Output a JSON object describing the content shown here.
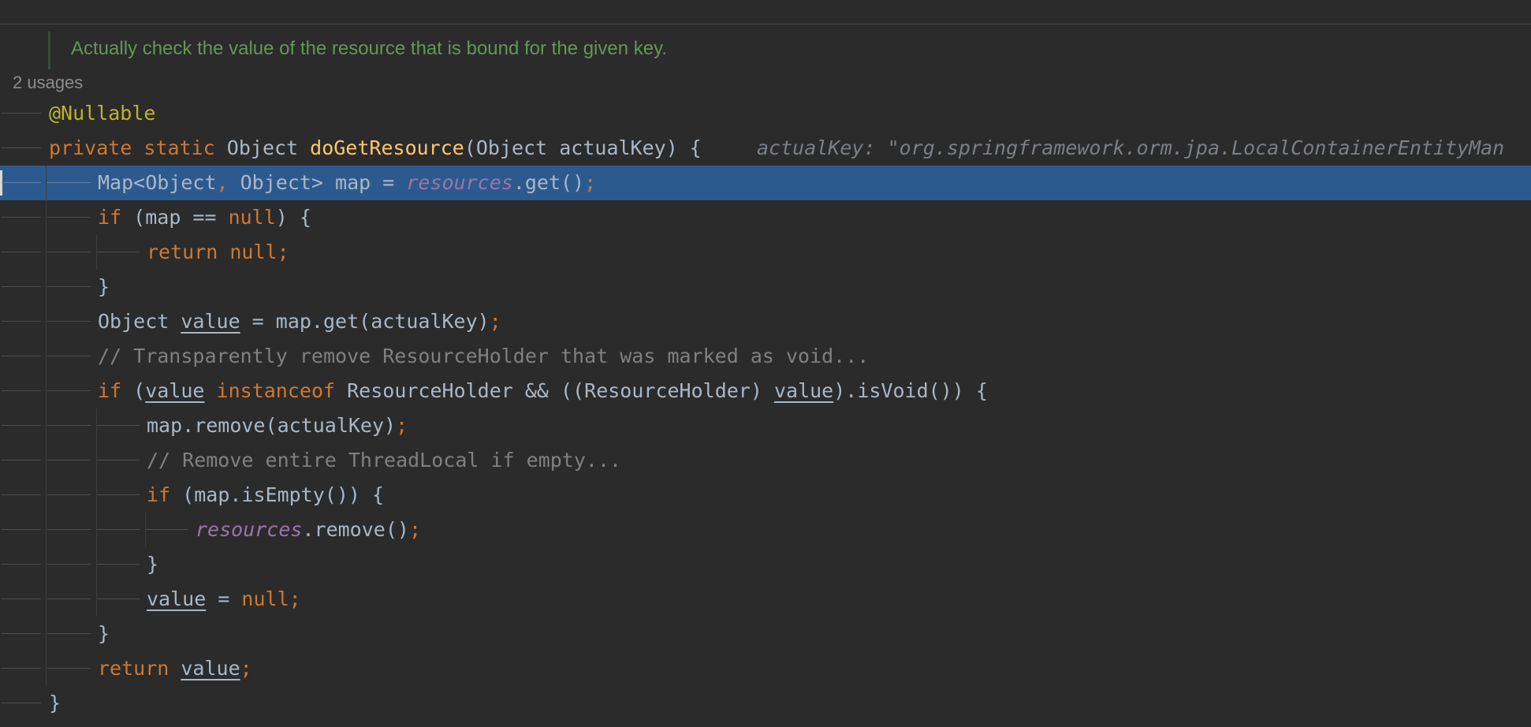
{
  "editor": {
    "doc_comment": "Actually check the value of the resource that is bound for the given key.",
    "usages_label": "2 usages",
    "inline_hint": "actualKey: \"org.springframework.orm.jpa.LocalContainerEntityMan",
    "lines": [
      {
        "id": "annotation",
        "tokens": [
          {
            "t": "@Nullable",
            "c": "ann"
          }
        ]
      },
      {
        "id": "signature",
        "tokens": [
          {
            "t": "private",
            "c": "kw"
          },
          {
            "t": " "
          },
          {
            "t": "static",
            "c": "kw"
          },
          {
            "t": " Object "
          },
          {
            "t": "doGetResource",
            "c": "fn"
          },
          {
            "t": "(Object actualKey) {"
          }
        ]
      },
      {
        "id": "map-decl",
        "tokens": [
          {
            "t": "Map<Object"
          },
          {
            "t": ",",
            "c": "kw"
          },
          {
            "t": " Object> map = "
          },
          {
            "t": "resources",
            "c": "field"
          },
          {
            "t": ".get()"
          },
          {
            "t": ";",
            "c": "kw"
          }
        ]
      },
      {
        "id": "if-null",
        "tokens": [
          {
            "t": "if",
            "c": "kw"
          },
          {
            "t": " (map == "
          },
          {
            "t": "null",
            "c": "kw"
          },
          {
            "t": ") {"
          }
        ]
      },
      {
        "id": "return-null",
        "tokens": [
          {
            "t": "return",
            "c": "kw"
          },
          {
            "t": " "
          },
          {
            "t": "null",
            "c": "kw"
          },
          {
            "t": ";",
            "c": "kw"
          }
        ]
      },
      {
        "id": "close-1",
        "tokens": [
          {
            "t": "}"
          }
        ]
      },
      {
        "id": "value-decl",
        "tokens": [
          {
            "t": "Object "
          },
          {
            "t": "value",
            "c": "ul"
          },
          {
            "t": " = map.get(actualKey)"
          },
          {
            "t": ";",
            "c": "kw"
          }
        ]
      },
      {
        "id": "comment-1",
        "tokens": [
          {
            "t": "// Transparently remove ResourceHolder that was marked as void...",
            "c": "cmt"
          }
        ]
      },
      {
        "id": "if-void",
        "tokens": [
          {
            "t": "if",
            "c": "kw"
          },
          {
            "t": " ("
          },
          {
            "t": "value",
            "c": "ul"
          },
          {
            "t": " "
          },
          {
            "t": "instanceof",
            "c": "kw"
          },
          {
            "t": " ResourceHolder && ((ResourceHolder) "
          },
          {
            "t": "value",
            "c": "ul"
          },
          {
            "t": ").isVoid()) {"
          }
        ]
      },
      {
        "id": "map-remove",
        "tokens": [
          {
            "t": "map.remove(actualKey)"
          },
          {
            "t": ";",
            "c": "kw"
          }
        ]
      },
      {
        "id": "comment-2",
        "tokens": [
          {
            "t": "// Remove entire ThreadLocal if empty...",
            "c": "cmt"
          }
        ]
      },
      {
        "id": "if-empty",
        "tokens": [
          {
            "t": "if",
            "c": "kw"
          },
          {
            "t": " (map.isEmpty()) {"
          }
        ]
      },
      {
        "id": "resources-remove",
        "tokens": [
          {
            "t": "resources",
            "c": "field"
          },
          {
            "t": ".remove()"
          },
          {
            "t": ";",
            "c": "kw"
          }
        ]
      },
      {
        "id": "close-2",
        "tokens": [
          {
            "t": "}"
          }
        ]
      },
      {
        "id": "value-null",
        "tokens": [
          {
            "t": "value",
            "c": "ul"
          },
          {
            "t": " = "
          },
          {
            "t": "null",
            "c": "kw"
          },
          {
            "t": ";",
            "c": "kw"
          }
        ]
      },
      {
        "id": "close-3",
        "tokens": [
          {
            "t": "}"
          }
        ]
      },
      {
        "id": "return-value",
        "tokens": [
          {
            "t": "return",
            "c": "kw"
          },
          {
            "t": " "
          },
          {
            "t": "value",
            "c": "ul"
          },
          {
            "t": ";",
            "c": "kw"
          }
        ]
      },
      {
        "id": "close-method",
        "tokens": [
          {
            "t": "}"
          }
        ]
      }
    ]
  },
  "colors": {
    "background": "#2b2b2b",
    "current_line": "#2d5a8e",
    "keyword": "#cc7832",
    "annotation": "#bbb529",
    "method": "#ffc66d",
    "field": "#9876aa",
    "comment": "#808080",
    "doc_comment": "#629755",
    "default_text": "#a9b7c6"
  }
}
